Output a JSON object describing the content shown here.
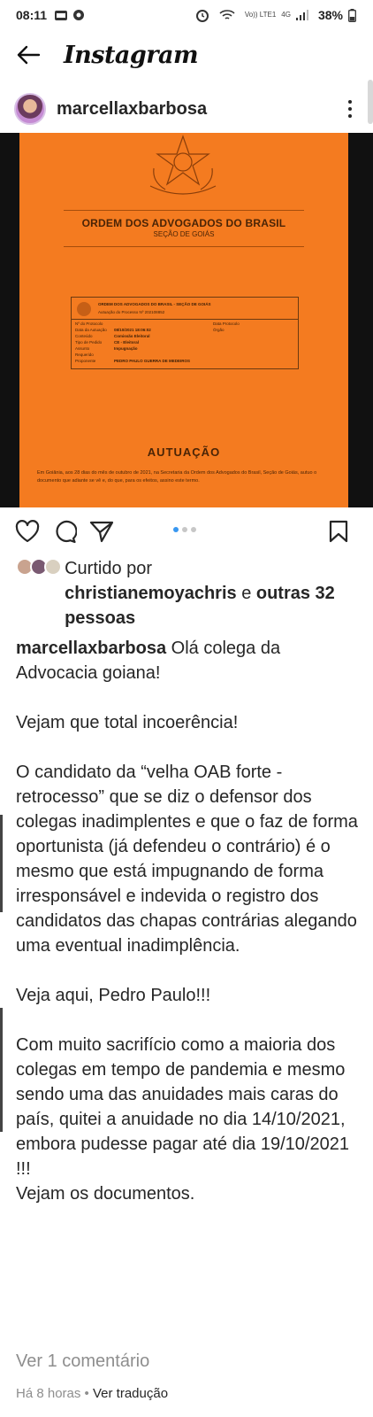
{
  "status_bar": {
    "time": "08:11",
    "network_label": "Vo)) LTE1",
    "signal_label": "4G",
    "battery": "38%"
  },
  "app": {
    "title": "Instagram"
  },
  "post": {
    "username": "marcellaxbarbosa",
    "image": {
      "org_name": "ORDEM DOS ADVOGADOS DO BRASIL",
      "section": "SEÇÃO DE GOIÁS",
      "form_header": "ORDEM DOS ADVOGADOS DO BRASIL - SEÇÃO DE GOIÁS",
      "form_process": "Autuação do Processo Nº 202108852",
      "form_rows": [
        {
          "label": "Nº do Protocolo",
          "value": ""
        },
        {
          "label": "Data da Autuação",
          "value": "08/10/2021 18:06:02"
        },
        {
          "label": "Conteúdo",
          "value": "Comissão Eleitoral"
        },
        {
          "label": "Tipo de Pedido",
          "value": "CE - Eleitoral"
        },
        {
          "label": "Assunto",
          "value": "Impugnação"
        },
        {
          "label": "Requerido",
          "value": ""
        },
        {
          "label": "Proponente",
          "value": "PEDRO PAULO GUERRA DE MEDEIROS"
        }
      ],
      "form_side_labels": [
        "Data Protocolo",
        "Órgão"
      ],
      "doc_title": "AUTUAÇÃO",
      "footer_text": "Em Goiânia, aos 28 dias do mês de outubro de 2021, na Secretaria da Ordem dos Advogados do Brasil, Seção de Goiás, autuo o documento que adiante se vê e, do que, para os efeitos, assino este termo."
    },
    "likes": {
      "prefix": "Curtido por",
      "user": "christianemoyachris",
      "connector": "e",
      "others": "outras 32 pessoas"
    },
    "caption_user": "marcellaxbarbosa",
    "caption_text": "Olá colega da Advocacia goiana!\n\nVejam que total incoerência!\n\nO candidato da “velha OAB forte - retrocesso” que se diz o defensor dos colegas inadimplentes e que o faz de forma oportunista (já defendeu o contrário) é o mesmo que está impugnando de forma irresponsável e indevida o registro dos candidatos das chapas contrárias alegando uma eventual inadimplência.\n\nVeja aqui, Pedro Paulo!!!\n\nCom muito sacrifício como a maioria dos colegas em tempo de pandemia e mesmo sendo uma das anuidades mais caras do país, quitei a anuidade no dia 14/10/2021, embora pudesse pagar até dia 19/10/2021 !!!\nVejam os documentos.",
    "view_comments": "Ver 1 comentário",
    "timestamp": "Há 8 horas",
    "separator": "•",
    "translate": "Ver tradução",
    "carousel": {
      "count": 3,
      "active": 0
    }
  },
  "colors": {
    "doc_orange": "#f47b20",
    "accent_blue": "#3897f0",
    "muted": "#8e8e8e"
  },
  "icons": [
    "back-arrow-icon",
    "more-options-icon",
    "heart-icon",
    "comment-icon",
    "share-icon",
    "bookmark-icon",
    "alarm-icon",
    "wifi-icon",
    "signal-icon"
  ]
}
